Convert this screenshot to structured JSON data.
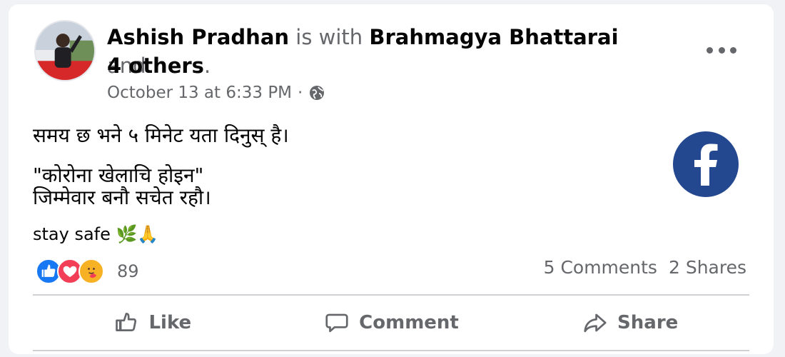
{
  "post": {
    "author": "Ashish Pradhan",
    "with_connector": "is with",
    "tagged": "Brahmagya Bhattarai",
    "and_word": "and",
    "others": "4 others",
    "period": ".",
    "timestamp": "October 13 at 6:33 PM",
    "separator": "·",
    "privacy_icon": "globe-icon",
    "lines": [
      "समय छ भने ५ मिनेट यता दिनुस् है।",
      "\"कोरोना खेलाचि होइन\"",
      "जिम्मेवार बनौ सचेत रहौ।",
      "stay safe 🌿🙏"
    ]
  },
  "reactions": {
    "icons": [
      "like-reaction-icon",
      "love-reaction-icon",
      "care-reaction-icon"
    ],
    "count": "89",
    "comments": "5 Comments",
    "shares": "2 Shares"
  },
  "actions": {
    "like": "Like",
    "comment": "Comment",
    "share": "Share"
  },
  "colors": {
    "facebook_blue": "#24488f",
    "like_blue": "#1877f2",
    "love_red": "#f33e58",
    "care_yellow": "#f7b125",
    "muted_text": "#65676b"
  }
}
